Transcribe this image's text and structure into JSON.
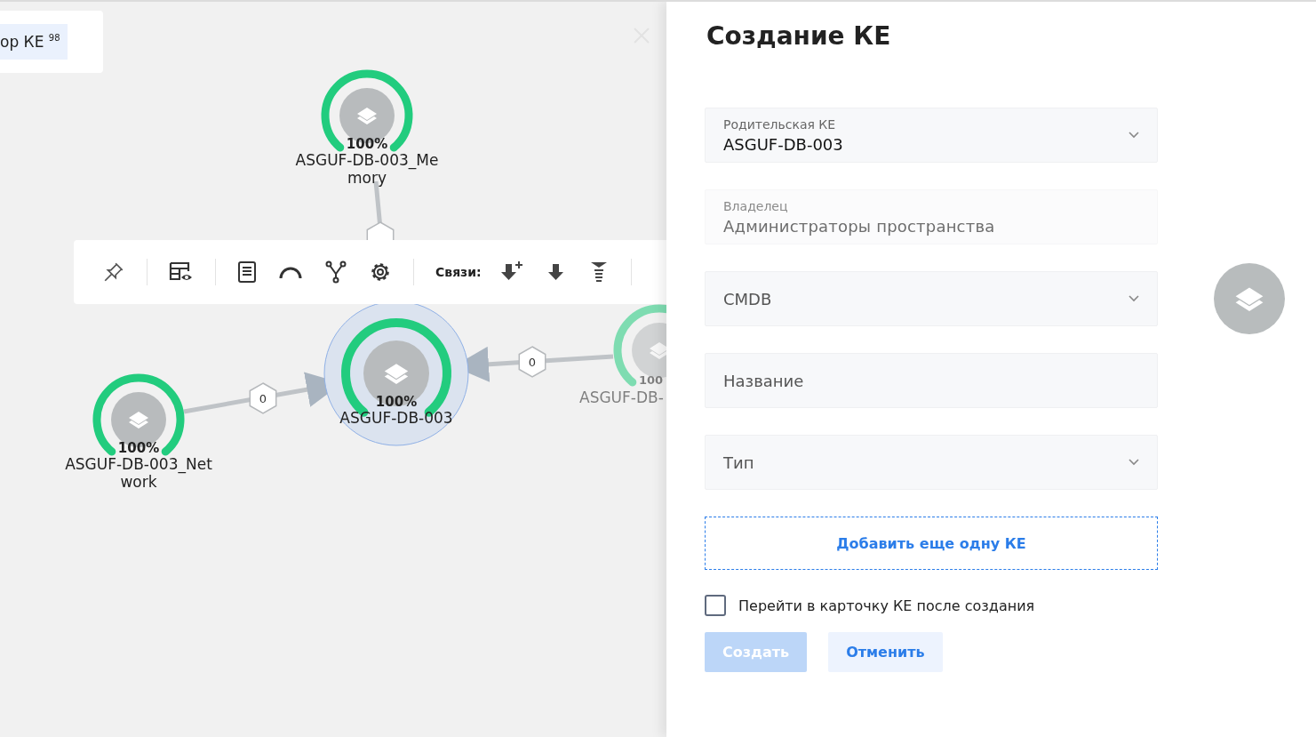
{
  "canvas": {
    "chip": "ор КЕ $^{98}$",
    "nodes": [
      {
        "percent": "100%",
        "lines": [
          "ASGUF-DB-003_Me",
          "mory"
        ],
        "selected": false
      },
      {
        "percent": "100%",
        "lines": [
          "ASGUF-DB-003_Net",
          "work"
        ],
        "selected": false
      },
      {
        "percent": "100%",
        "lines": [
          "ASGUF-DB-003"
        ],
        "selected": true
      },
      {
        "percent": "100",
        "lines": [
          "ASGUF-DB-"
        ],
        "selected": false
      }
    ],
    "edges": [
      {
        "count": "0"
      },
      {
        "count": "0"
      }
    ],
    "toolbar": {
      "links_label": "Связи:"
    }
  },
  "panel": {
    "title": "Создание КЕ",
    "fields": [
      {
        "kind": "select",
        "label": "Родительская КЕ",
        "value": "ASGUF-DB-003",
        "disabled": false
      },
      {
        "kind": "input",
        "label": "Владелец",
        "value": "Администраторы пространства",
        "disabled": true
      },
      {
        "kind": "select",
        "placeholder": "CMDB",
        "disabled": false
      },
      {
        "kind": "input",
        "placeholder": "Название",
        "disabled": false
      },
      {
        "kind": "select",
        "placeholder": "Тип",
        "disabled": false
      }
    ],
    "add_button": "Добавить еще одну КЕ",
    "checkbox": {
      "label": "Перейти в карточку КЕ после создания",
      "checked": false
    },
    "buttons": [
      {
        "label": "Создать",
        "kind": "primary",
        "disabled": true
      },
      {
        "label": "Отменить",
        "kind": "secondary",
        "disabled": false
      }
    ]
  }
}
